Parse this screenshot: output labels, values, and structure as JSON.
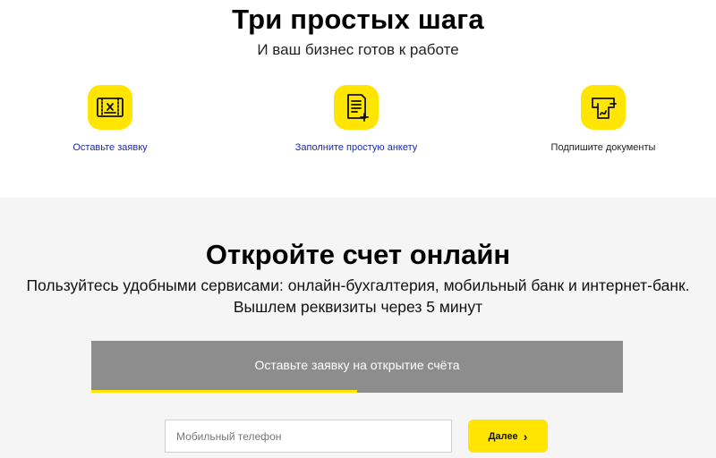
{
  "steps_section": {
    "title": "Три простых шага",
    "subtitle": "И ваш бизнес готов к работе",
    "steps": [
      {
        "label": "Оставьте заявку",
        "icon": "application-form-icon"
      },
      {
        "label": "Заполните простую анкету",
        "icon": "document-add-icon"
      },
      {
        "label": "Подпишите документы",
        "icon": "sign-document-icon"
      }
    ]
  },
  "open_section": {
    "title": "Откройте счет онлайн",
    "description_line1": "Пользуйтесь удобными сервисами: онлайн-бухгалтерия, мобильный банк и интернет-банк.",
    "description_line2": "Вышлем реквизиты через 5 минут",
    "form": {
      "header": "Оставьте заявку на открытие счёта",
      "progress": 0.5,
      "phone_placeholder": "Мобильный телефон",
      "phone_value": "",
      "next_label": "Далее",
      "next_icon": "chevron-right-icon"
    }
  },
  "colors": {
    "accent": "#ffe500",
    "link": "#1b2ba8",
    "panel": "#8d8d8d",
    "section_bg": "#f5f5f5"
  }
}
